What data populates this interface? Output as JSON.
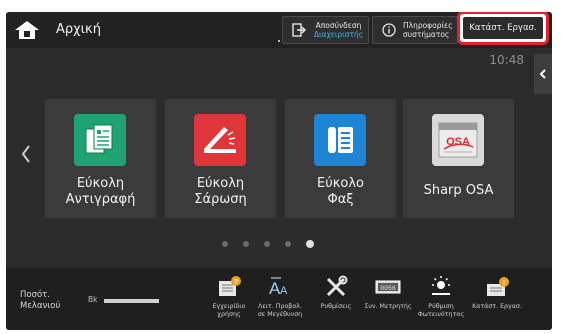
{
  "header": {
    "title": "Αρχική",
    "logout_line1": "Αποσύνδεση",
    "logout_line2": "Διαχειριστής",
    "sysinfo_line1": "Πληροφορίες",
    "sysinfo_line2": "συστήματος",
    "job_status_label": "Κατάστ. Εργασ."
  },
  "clock": "10:48",
  "tiles": [
    {
      "label_line1": "Εύκολη",
      "label_line2": "Αντιγραφή",
      "icon": "copy-document-icon",
      "color": "#1fa372"
    },
    {
      "label_line1": "Εύκολη",
      "label_line2": "Σάρωση",
      "icon": "scanner-icon",
      "color": "#e0363a"
    },
    {
      "label_line1": "Εύκολο",
      "label_line2": "Φαξ",
      "icon": "fax-icon",
      "color": "#1e84d4"
    },
    {
      "label_line1": "Sharp OSA",
      "label_line2": "",
      "icon": "sharp-osa-icon",
      "color": "#c9c9c9"
    }
  ],
  "pager": {
    "count": 5,
    "active_index": 4
  },
  "bottom": {
    "toner_line1": "Ποσότ.",
    "toner_line2": "Μελανιού",
    "toner_color": "Bk",
    "toner_level": 1.0,
    "items": [
      {
        "line1": "Εγχειρίδιο",
        "line2": "χρήσης",
        "icon": "manual-icon"
      },
      {
        "line1": "Λειτ. Προβολ.",
        "line2": "σε Μεγέθυνση",
        "icon": "font-size-icon"
      },
      {
        "line1": "Ρυθμίσεις",
        "line2": "",
        "icon": "tools-icon"
      },
      {
        "line1": "Συν. Μετρητής",
        "line2": "",
        "icon": "counter-icon"
      },
      {
        "line1": "Ρύθμιση",
        "line2": "Φωτεινότητας",
        "icon": "brightness-icon"
      },
      {
        "line1": "Κατάστ. Εργασ.",
        "line2": "",
        "icon": "job-status-icon"
      }
    ]
  },
  "colors": {
    "accent_blue": "#40b4e6",
    "highlight_red": "#e0242f",
    "badge_orange": "#f0a020"
  }
}
